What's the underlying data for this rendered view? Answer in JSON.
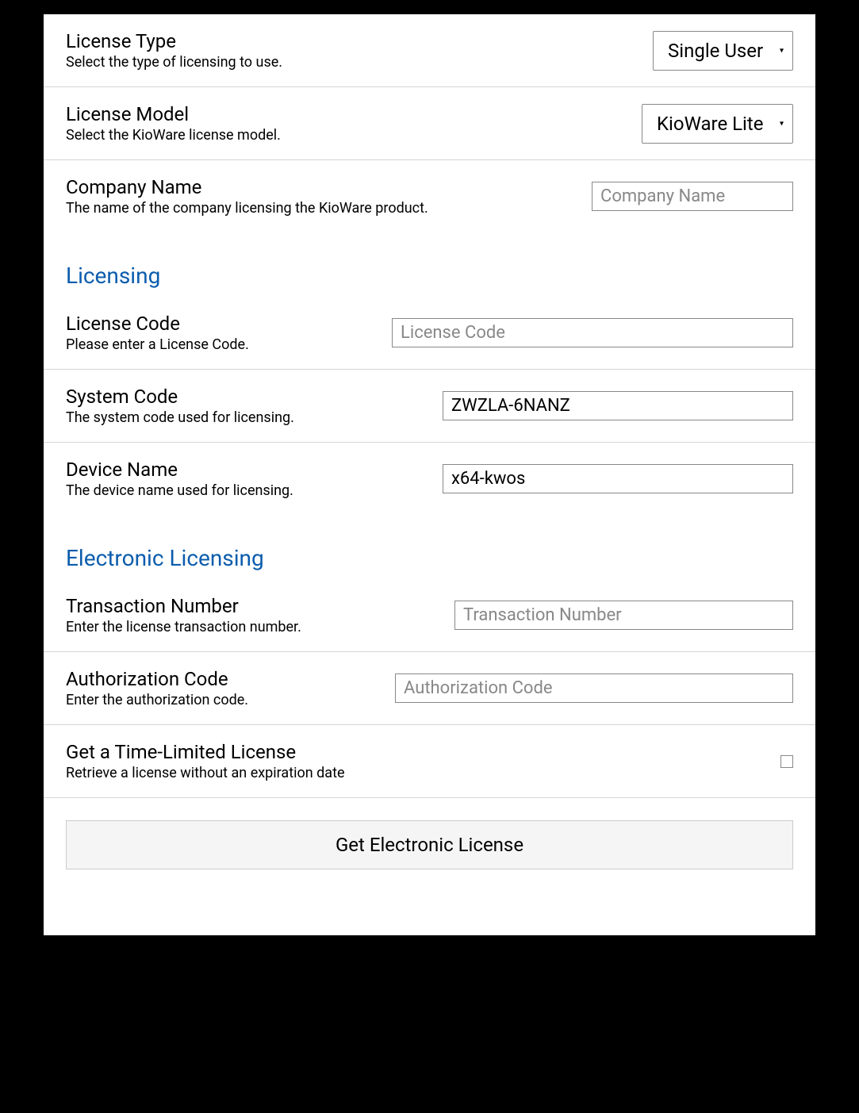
{
  "licenseType": {
    "title": "License Type",
    "desc": "Select the type of licensing to use.",
    "value": "Single User"
  },
  "licenseModel": {
    "title": "License Model",
    "desc": "Select the KioWare license model.",
    "value": "KioWare Lite"
  },
  "companyName": {
    "title": "Company Name",
    "desc": "The name of the company licensing the KioWare product.",
    "placeholder": "Company Name",
    "value": ""
  },
  "sections": {
    "licensing": "Licensing",
    "electronic": "Electronic Licensing"
  },
  "licenseCode": {
    "title": "License Code",
    "desc": "Please enter a License Code.",
    "placeholder": "License Code",
    "value": ""
  },
  "systemCode": {
    "title": "System Code",
    "desc": "The system code used for licensing.",
    "value": "ZWZLA-6NANZ"
  },
  "deviceName": {
    "title": "Device Name",
    "desc": "The device name used for licensing.",
    "value": "x64-kwos"
  },
  "transactionNumber": {
    "title": "Transaction Number",
    "desc": "Enter the license transaction number.",
    "placeholder": "Transaction Number",
    "value": ""
  },
  "authCode": {
    "title": "Authorization Code",
    "desc": "Enter the authorization code.",
    "placeholder": "Authorization Code",
    "value": ""
  },
  "timeLimited": {
    "title": "Get a Time-Limited License",
    "desc": "Retrieve a license without an expiration date"
  },
  "actionButton": "Get Electronic License"
}
